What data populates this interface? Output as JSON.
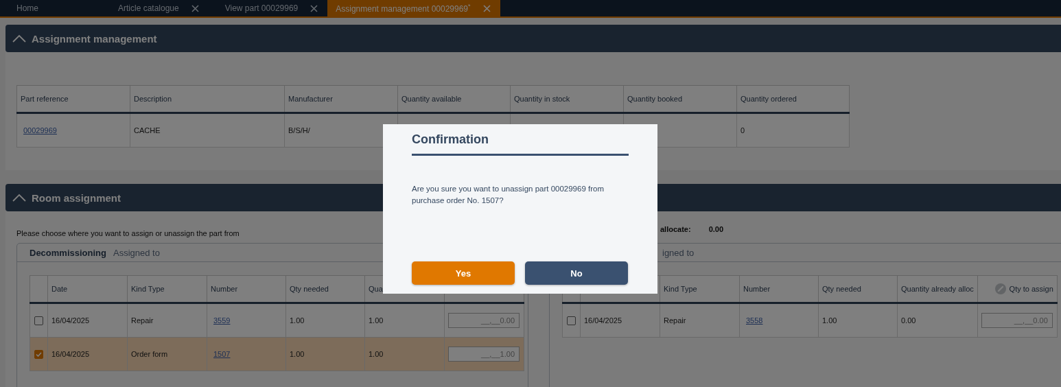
{
  "tabs": [
    {
      "label": "Home",
      "selected": false,
      "closable": false
    },
    {
      "label": "Article catalogue",
      "selected": false,
      "closable": true
    },
    {
      "label": "View part 00029969",
      "selected": false,
      "closable": true
    },
    {
      "label": "Assignment management 00029969$^{*}$",
      "selected": true,
      "closable": true
    }
  ],
  "assignment_section": {
    "title": "Assignment management",
    "expanded": true,
    "table": {
      "columns": [
        "Part reference",
        "Description",
        "Manufacturer",
        "Quantity available",
        "Quantity in stock",
        "Quantity booked",
        "Quantity ordered"
      ],
      "rows": [
        {
          "cells": [
            {
              "text": "00029969",
              "kind": "link"
            },
            {
              "text": "CACHE",
              "kind": "text"
            },
            {
              "text": "B/S/H/",
              "kind": "text"
            },
            {
              "kind": "hidden"
            },
            {
              "kind": "hidden"
            },
            {
              "kind": "hidden"
            },
            {
              "text": "0",
              "kind": "text"
            }
          ]
        }
      ]
    }
  },
  "room_section": {
    "title": "Room assignment",
    "expanded": true,
    "instruction": "Please choose where you want to assign or unassign the part from",
    "allocate_label": "allocate:",
    "allocate_value": "0.00",
    "panels": [
      {
        "title": "Decommissioning",
        "subtitle": "Assigned to",
        "columns": [
          {
            "kind": "check"
          },
          {
            "kind": "text",
            "label": "Date"
          },
          {
            "kind": "text",
            "label": "Kind Type"
          },
          {
            "kind": "link",
            "label": "Number"
          },
          {
            "kind": "text",
            "label": "Qty needed"
          },
          {
            "kind": "text",
            "label": "Qua"
          },
          {
            "kind": "input"
          }
        ],
        "rows": [
          {
            "checked": false,
            "cells": [
              "",
              "16/04/2025",
              "Repair",
              "3559",
              "1.00",
              "1.00",
              "__,__0.00"
            ]
          },
          {
            "checked": true,
            "cells": [
              "",
              "16/04/2025",
              "Order form",
              "1507",
              "1.00",
              "1.00",
              "__,__1.00"
            ]
          }
        ]
      },
      {
        "subtitle": "igned to",
        "columns": [
          {
            "kind": "check"
          },
          {
            "kind": "text"
          },
          {
            "kind": "text",
            "label": "Kind Type"
          },
          {
            "kind": "link",
            "label": "Number"
          },
          {
            "kind": "text",
            "label": "Qty needed"
          },
          {
            "kind": "text",
            "label": "Quantity already alloc"
          },
          {
            "kind": "input",
            "label": "Qty to assign"
          }
        ],
        "rows": [
          {
            "checked": false,
            "cells": [
              "",
              "16/04/2025",
              "Repair",
              "3558",
              "1.00",
              "0.00",
              "__,__0.00"
            ]
          }
        ]
      }
    ]
  },
  "dialog": {
    "title": "Confirmation",
    "message": "Are you sure you want to unassign part 00029969 from purchase order No. 1507?",
    "buttons": [
      {
        "label": "Yes",
        "kind": "primary"
      },
      {
        "label": "No",
        "kind": "secondary"
      }
    ]
  }
}
